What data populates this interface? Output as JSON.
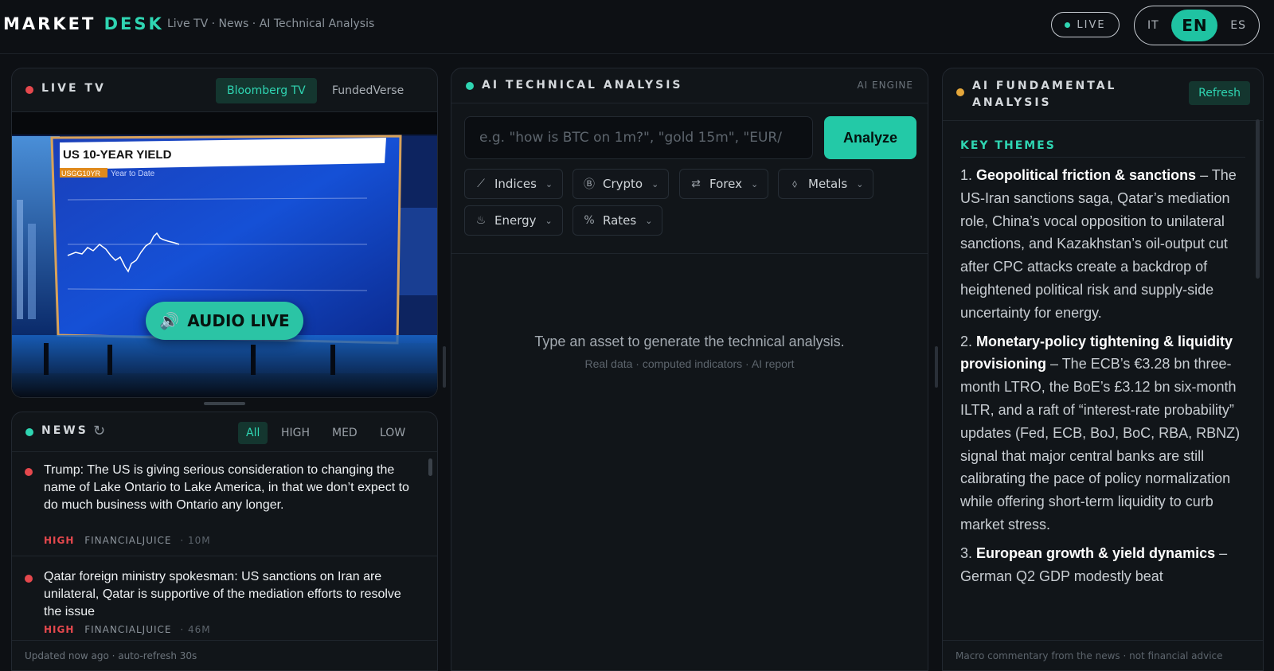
{
  "header": {
    "brand_part1": "MARKET",
    "brand_part2": "DESK",
    "breadcrumb": "Live TV · News · AI Technical Analysis",
    "live_label": "LIVE",
    "languages": [
      "IT",
      "EN",
      "ES"
    ],
    "active_language": "EN"
  },
  "livetv": {
    "title": "LIVE TV",
    "channels": [
      "Bloomberg TV",
      "FundedVerse"
    ],
    "active_channel": "Bloomberg TV",
    "video": {
      "chart_title": "US 10-YEAR YIELD",
      "ticker": "USGG10YR",
      "subtitle": "Year to Date"
    },
    "audio_live_label": "AUDIO LIVE"
  },
  "news": {
    "title": "NEWS",
    "filters": [
      "All",
      "HIGH",
      "MED",
      "LOW"
    ],
    "active_filter": "All",
    "items": [
      {
        "headline": "Trump: The US is giving serious consideration to changing the name of Lake Ontario to Lake America, in that we don’t expect to do much business with Ontario any longer.",
        "importance": "HIGH",
        "source": "FINANCIALJUICE",
        "age": "· 10M"
      },
      {
        "headline": "Qatar foreign ministry spokesman: US sanctions on Iran are unilateral, Qatar is supportive of the mediation efforts to resolve the issue",
        "importance": "HIGH",
        "source": "FINANCIALJUICE",
        "age": "· 46M"
      }
    ],
    "footer": "Updated now ago · auto-refresh 30s"
  },
  "technical": {
    "title": "AI TECHNICAL ANALYSIS",
    "engine_label": "AI ENGINE",
    "input_placeholder": "e.g. \"how is BTC on 1m?\", \"gold 15m\", \"EUR/",
    "input_value": "",
    "analyze_label": "Analyze",
    "categories": [
      {
        "label": "Indices",
        "icon": "chart-line-icon"
      },
      {
        "label": "Crypto",
        "icon": "coin-icon"
      },
      {
        "label": "Forex",
        "icon": "swap-icon"
      },
      {
        "label": "Metals",
        "icon": "gem-icon"
      },
      {
        "label": "Energy",
        "icon": "flame-icon"
      },
      {
        "label": "Rates",
        "icon": "percent-icon"
      }
    ],
    "empty_title": "Type an asset to generate the technical analysis.",
    "empty_subtitle": "Real data · computed indicators · AI report"
  },
  "fundamental": {
    "title": "AI FUNDAMENTAL ANALYSIS",
    "refresh_label": "Refresh",
    "section_title": "KEY THEMES",
    "themes": [
      {
        "num": "1.",
        "title": "Geopolitical friction & sanctions",
        "body": " – The US-Iran sanctions saga, Qatar’s mediation role, China’s vocal opposition to unilateral sanctions, and Kazakhstan’s oil-output cut after CPC attacks create a backdrop of heightened political risk and supply-side uncertainty for energy."
      },
      {
        "num": "2.",
        "title": "Monetary-policy tightening & liquidity provisioning",
        "body": " – The ECB’s €3.28 bn three-month LTRO, the BoE’s £3.12 bn six-month ILTR, and a raft of “interest-rate probability” updates (Fed, ECB, BoJ, BoC, RBA, RBNZ) signal that major central banks are still calibrating the pace of policy normalization while offering short-term liquidity to curb market stress."
      },
      {
        "num": "3.",
        "title": "European growth & yield dynamics",
        "body": " – German Q2 GDP modestly beat"
      }
    ],
    "footer": "Macro commentary from the news · not financial advice"
  },
  "colors": {
    "accent": "#2fd5b2",
    "high": "#e5484d",
    "fundamental_dot": "#e5a73b",
    "background": "#0d1014"
  }
}
